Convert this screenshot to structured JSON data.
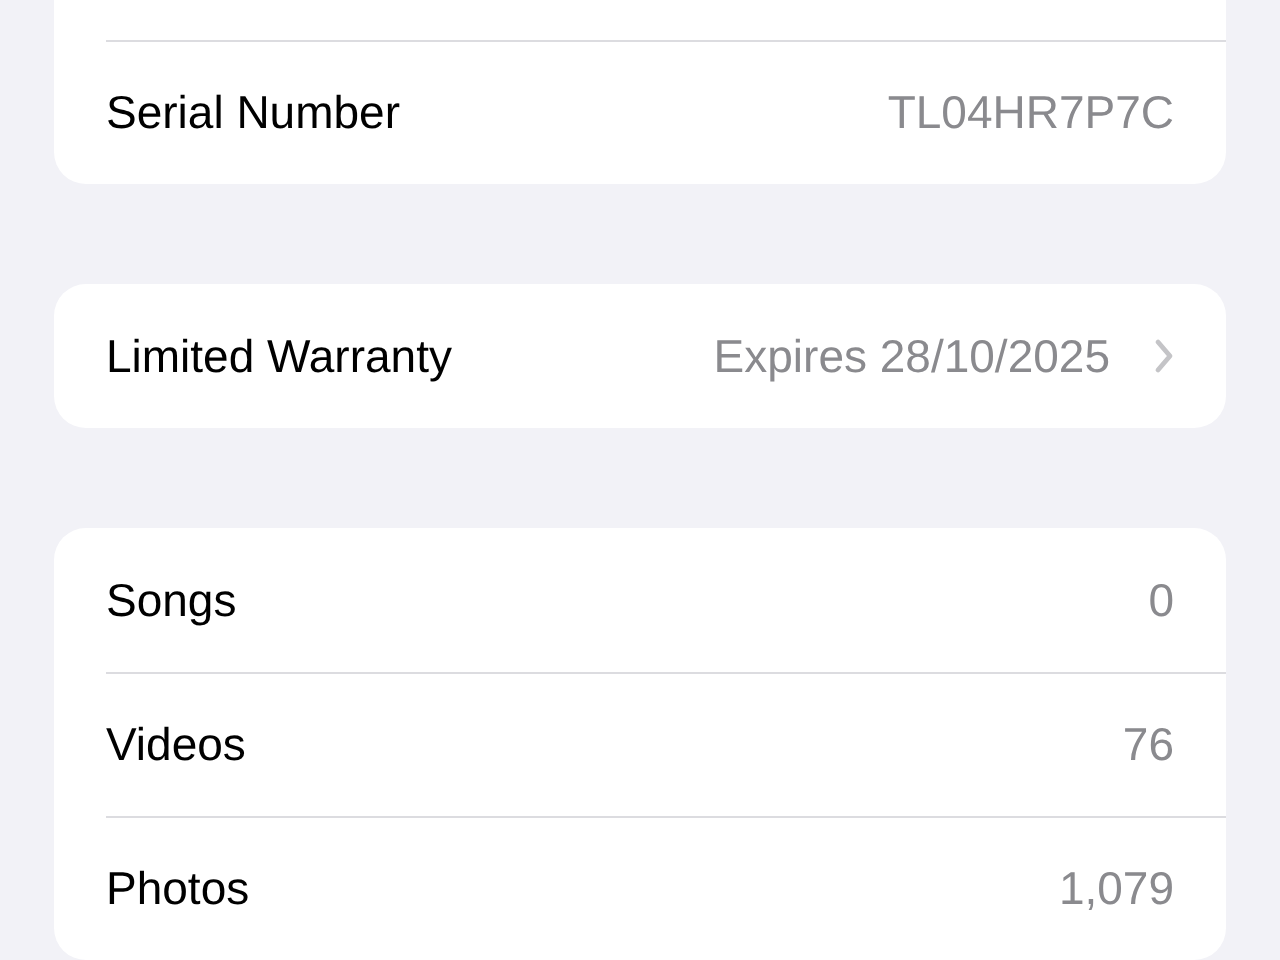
{
  "sections": [
    {
      "rows": [
        {
          "label": "Serial Number",
          "value": "TL04HR7P7C",
          "chevron": false
        }
      ]
    },
    {
      "rows": [
        {
          "label": "Limited Warranty",
          "value": "Expires 28/10/2025",
          "chevron": true
        }
      ]
    },
    {
      "rows": [
        {
          "label": "Songs",
          "value": "0",
          "chevron": false
        },
        {
          "label": "Videos",
          "value": "76",
          "chevron": false
        },
        {
          "label": "Photos",
          "value": "1,079",
          "chevron": false
        }
      ]
    }
  ]
}
